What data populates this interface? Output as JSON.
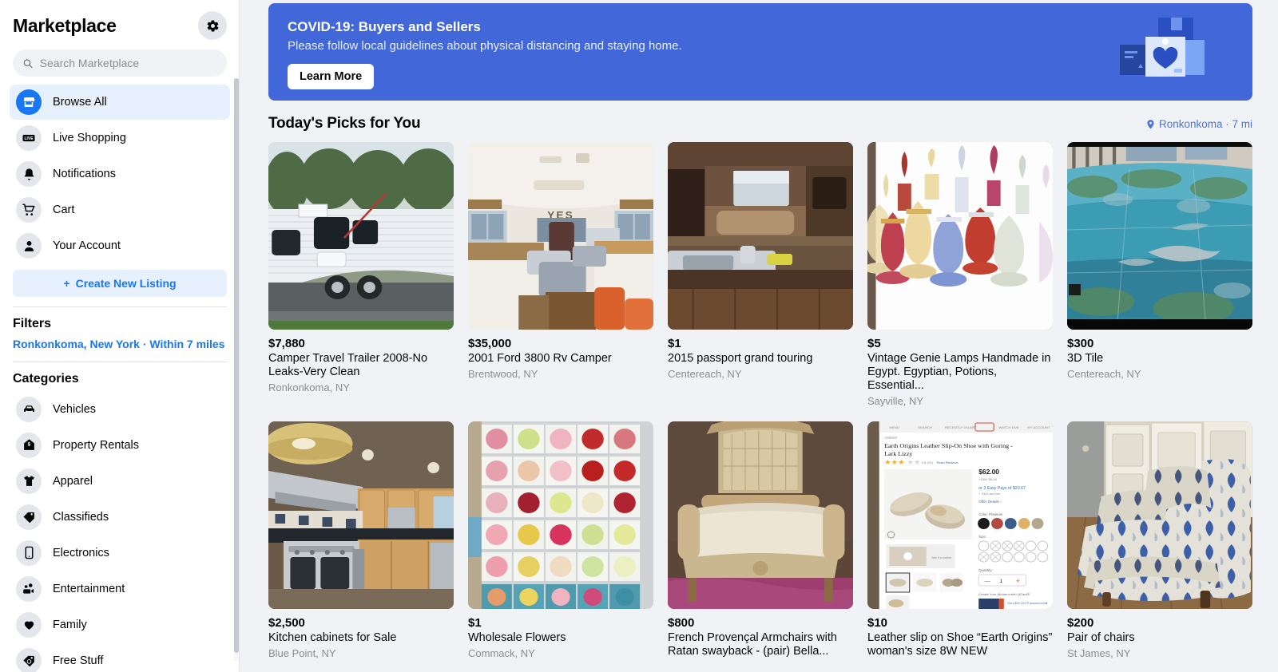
{
  "sidebar": {
    "title": "Marketplace",
    "gear_label": "gear-icon",
    "search": {
      "placeholder": "Search Marketplace",
      "value": ""
    },
    "nav": [
      {
        "label": "Browse All",
        "icon": "store-icon",
        "active": true
      },
      {
        "label": "Live Shopping",
        "icon": "live-icon",
        "active": false
      },
      {
        "label": "Notifications",
        "icon": "bell-icon",
        "active": false
      },
      {
        "label": "Cart",
        "icon": "cart-icon",
        "active": false
      },
      {
        "label": "Your Account",
        "icon": "person-icon",
        "active": false
      }
    ],
    "create_listing": "Create New Listing",
    "filters_title": "Filters",
    "filter_location": "Ronkonkoma, New York · Within 7 miles",
    "categories_title": "Categories",
    "categories": [
      {
        "label": "Vehicles",
        "icon": "car-icon"
      },
      {
        "label": "Property Rentals",
        "icon": "house-dollar-icon"
      },
      {
        "label": "Apparel",
        "icon": "tshirt-icon"
      },
      {
        "label": "Classifieds",
        "icon": "tag-icon"
      },
      {
        "label": "Electronics",
        "icon": "phone-icon"
      },
      {
        "label": "Entertainment",
        "icon": "film-people-icon"
      },
      {
        "label": "Family",
        "icon": "heart-icon"
      },
      {
        "label": "Free Stuff",
        "icon": "tag-free-icon"
      }
    ]
  },
  "banner": {
    "title": "COVID-19: Buyers and Sellers",
    "subtitle": "Please follow local guidelines about physical distancing and staying home.",
    "button": "Learn More",
    "bg_color": "#4267d8"
  },
  "picks": {
    "title": "Today's Picks for You",
    "location": "Ronkonkoma · 7 mi"
  },
  "listings": [
    {
      "price": "$7,880",
      "title": "Camper Travel Trailer 2008-No Leaks-Very Clean",
      "location": "Ronkonkoma, NY",
      "image": "camper-trailer"
    },
    {
      "price": "$35,000",
      "title": "2001 Ford 3800 Rv Camper",
      "location": "Brentwood, NY",
      "image": "bus-interior"
    },
    {
      "price": "$1",
      "title": "2015 passport grand touring",
      "location": "Centereach, NY",
      "image": "rv-interior"
    },
    {
      "price": "$5",
      "title": "Vintage Genie Lamps Handmade in Egypt. Egyptian, Potions, Essential...",
      "location": "Sayville, NY",
      "image": "genie-lamps"
    },
    {
      "price": "$300",
      "title": "3D Tile",
      "location": "Centereach, NY",
      "image": "3d-tile-ocean"
    },
    {
      "price": "$2,500",
      "title": "Kitchen cabinets for Sale",
      "location": "Blue Point, NY",
      "image": "kitchen"
    },
    {
      "price": "$1",
      "title": "Wholesale Flowers",
      "location": "Commack, NY",
      "image": "flowers"
    },
    {
      "price": "$800",
      "title": "French Provençal Armchairs with Ratan swayback - (pair) Bella...",
      "location": "",
      "image": "armchair"
    },
    {
      "price": "$10",
      "title": "Leather slip on Shoe “Earth Origins” woman's size 8W NEW",
      "location": "",
      "image": "shoe-listing"
    },
    {
      "price": "$200",
      "title": "Pair of chairs",
      "location": "St James, NY",
      "image": "blue-chairs"
    }
  ]
}
